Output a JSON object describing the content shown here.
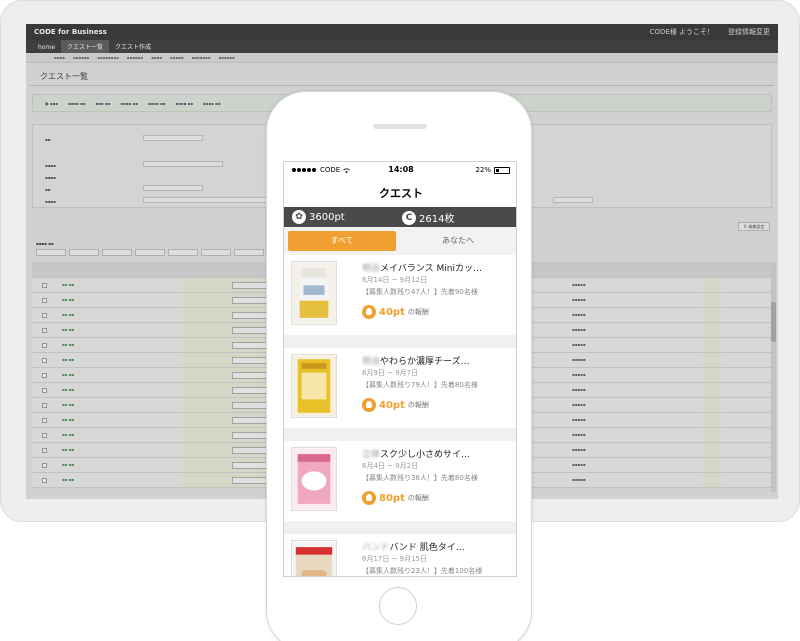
{
  "desktop": {
    "brand": "CODE for Business",
    "user_greeting": "CODE様 ようこそ！",
    "account_link": "登録情報変更",
    "nav_tabs": [
      "home",
      "クエスト一覧",
      "クエスト作成"
    ],
    "page_title": "クエスト一覧",
    "settings_button": "© 編集設定"
  },
  "phone": {
    "status": {
      "carrier": "CODE",
      "time": "14:08",
      "battery": "22%"
    },
    "title": "クエスト",
    "stats": {
      "points": "3600pt",
      "coins": "2614枚"
    },
    "tabs": {
      "all": "すべて",
      "for_you": "あなたへ"
    },
    "cards": [
      {
        "name_blur": "明治",
        "name": "メイバランス Miniカッ…",
        "date": "6月14日 ~ 9月12日",
        "recruit": "【募集人数残り47人！】先着90名様",
        "points": "40pt",
        "reward_label": "の報酬"
      },
      {
        "name_blur": "明治",
        "name": "やわらか濃厚チーズ…",
        "date": "6月9日 ~ 9月7日",
        "recruit": "【募集人数残り79人！】先着80名様",
        "points": "40pt",
        "reward_label": "の報酬"
      },
      {
        "name_blur": "立体",
        "name": "スク少し小さめサイ…",
        "date": "6月4日 ~ 9月2日",
        "recruit": "【募集人数残り38人！】先着80名様",
        "points": "80pt",
        "reward_label": "の報酬"
      },
      {
        "name_blur": "バンド",
        "name": "バンド 肌色タイ…",
        "date": "6月17日 ~ 9月15日",
        "recruit": "【募集人数残り23人！】先着100名様",
        "points": "",
        "reward_label": ""
      }
    ]
  }
}
